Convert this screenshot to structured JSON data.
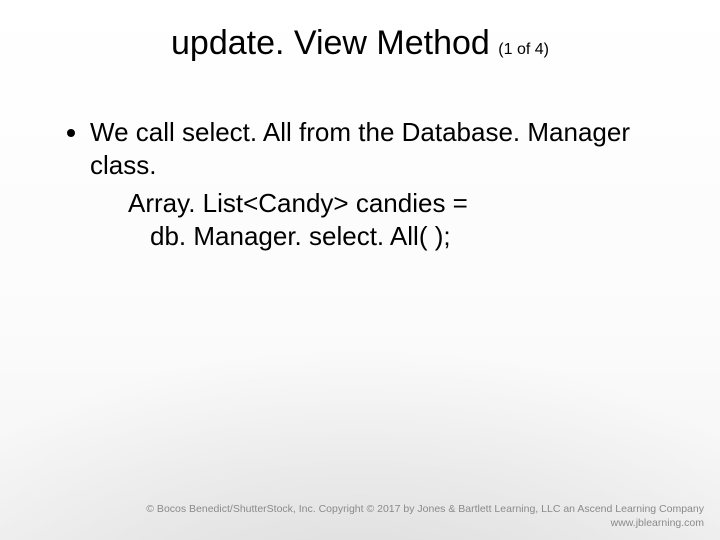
{
  "title": "update. View Method",
  "subtitle": "(1 of 4)",
  "bullet_text": "We call select. All from the Database. Manager class.",
  "code_line_1": "Array. List<Candy> candies =",
  "code_line_2": "db. Manager. select. All( );",
  "footer_line_1": "© Bocos Benedict/ShutterStock, Inc. Copyright © 2017 by Jones & Bartlett Learning, LLC an Ascend Learning Company",
  "footer_line_2": "www.jblearning.com"
}
